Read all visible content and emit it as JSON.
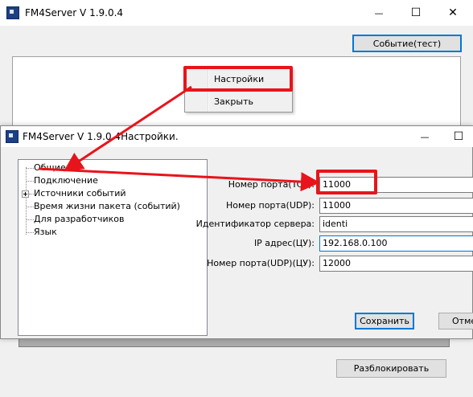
{
  "main_window": {
    "title": "FM4Server V 1.9.0.4",
    "event_test_button": "Событие(тест)",
    "unlock_button": "Разблокировать",
    "controls": {
      "minimize": "—",
      "maximize": "☐",
      "close": "✕"
    }
  },
  "context_menu": {
    "items": [
      "Настройки",
      "Закрыть"
    ]
  },
  "settings_window": {
    "title": "FM4Server V 1.9.0.4Настройки.",
    "controls": {
      "minimize": "—",
      "maximize": "☐"
    },
    "tree": [
      "Общие",
      "Подключение",
      "Источники событий",
      "Время жизни пакета (событий)",
      "Для разработчиков",
      "Язык"
    ],
    "fields": [
      {
        "label": "Номер порта(TCP):",
        "value": "11000"
      },
      {
        "label": "Номер порта(UDP):",
        "value": "11000"
      },
      {
        "label": "Идентификатор сервера:",
        "value": "identi"
      },
      {
        "label": "IP адрес(ЦУ):",
        "value": "192.168.0.100"
      },
      {
        "label": "Номер порта(UDP)(ЦУ):",
        "value": "12000"
      }
    ],
    "save_button": "Сохранить",
    "cancel_button": "Отмена"
  },
  "annotation": {
    "color": "#e8141b"
  }
}
